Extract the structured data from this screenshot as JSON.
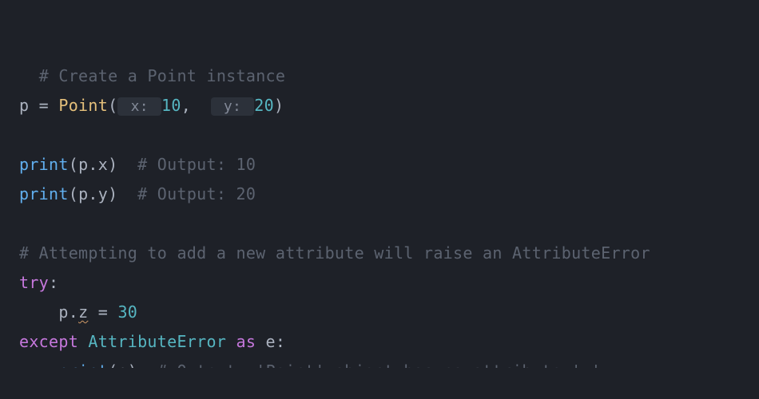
{
  "code": {
    "comment1": "# Create a Point instance",
    "line2": {
      "var": "p",
      "eq": " = ",
      "cls": "Point",
      "lparen": "(",
      "hint_x": " x: ",
      "val_x": "10",
      "comma": ",  ",
      "hint_y": " y: ",
      "val_y": "20",
      "rparen": ")"
    },
    "line4": {
      "print": "print",
      "lparen": "(",
      "expr": "p.x",
      "rparen": ")",
      "gap": "  ",
      "comment": "# Output: 10"
    },
    "line5": {
      "print": "print",
      "lparen": "(",
      "expr": "p.y",
      "rparen": ")",
      "gap": "  ",
      "comment": "# Output: 20"
    },
    "comment2": "# Attempting to add a new attribute will raise an AttributeError",
    "line8": {
      "try": "try",
      "colon": ":"
    },
    "line9": {
      "indent": "    ",
      "obj": "p.",
      "attr": "z",
      "eq": " = ",
      "val": "30"
    },
    "line10": {
      "except": "except",
      "sp1": " ",
      "exc": "AttributeError",
      "sp2": " ",
      "as": "as",
      "sp3": " ",
      "var": "e",
      "colon": ":"
    },
    "line11": {
      "indent": "    ",
      "print": "print",
      "lparen": "(",
      "arg": "e",
      "rparen": ")",
      "gap": "  ",
      "comment": "# Output: 'Point' object has no attribute 'z'"
    }
  }
}
